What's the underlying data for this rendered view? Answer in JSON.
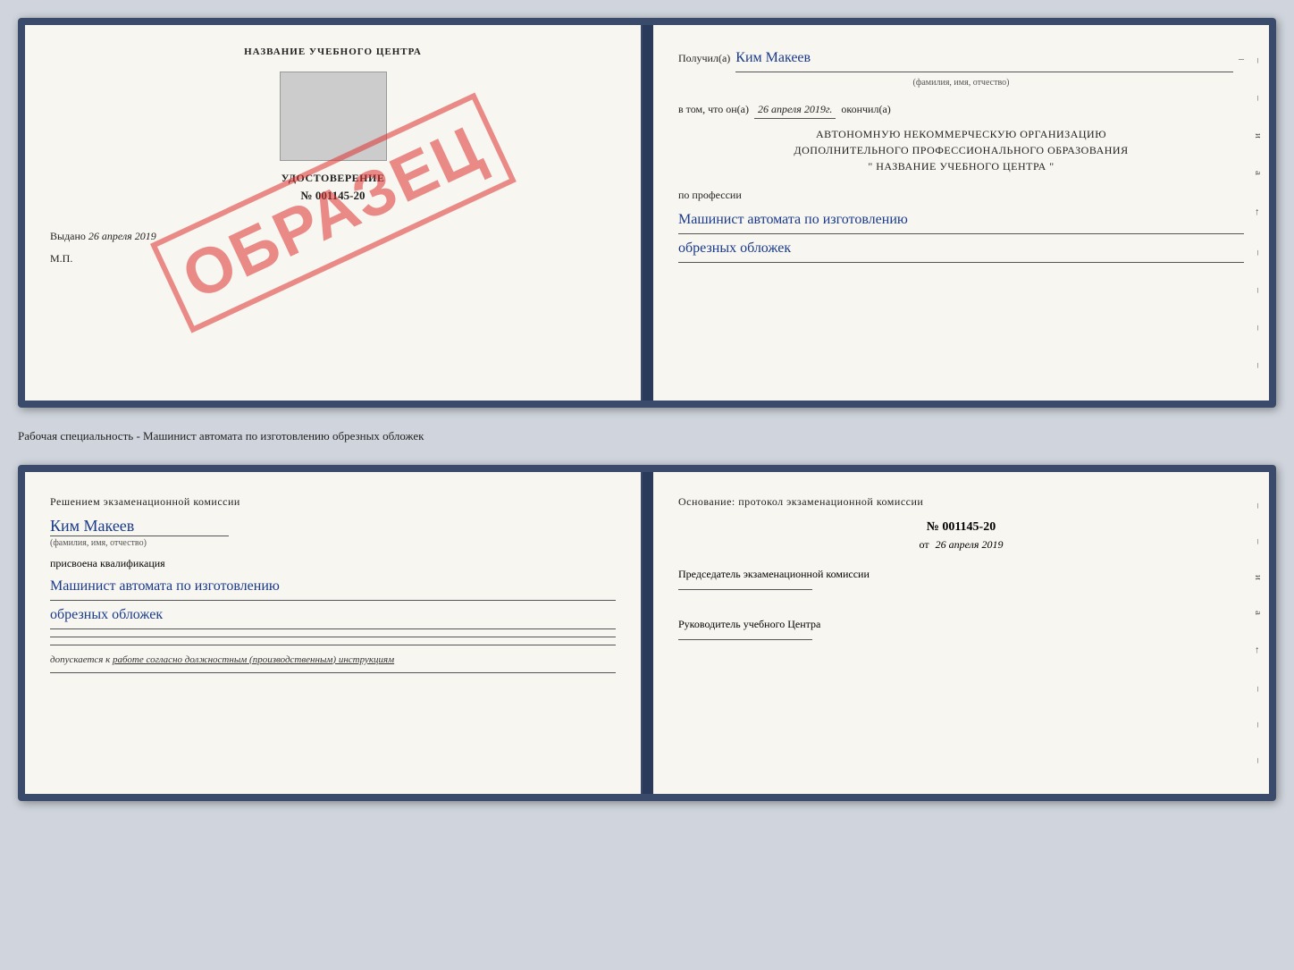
{
  "top_doc": {
    "left": {
      "header": "НАЗВАНИЕ УЧЕБНОГО ЦЕНТРА",
      "cert_label": "УДОСТОВЕРЕНИЕ",
      "cert_number": "№ 001145-20",
      "vydano_label": "Выдано",
      "vydano_date": "26 апреля 2019",
      "mp_label": "М.П.",
      "obrazets": "ОБРАЗЕЦ"
    },
    "right": {
      "poluchil_label": "Получил(а)",
      "poluchil_name": "Ким Макеев",
      "fio_label": "(фамилия, имя, отчество)",
      "vtom_label": "в том, что он(а)",
      "vtom_date": "26 апреля 2019г.",
      "okoncil_label": "окончил(а)",
      "org_line1": "АВТОНОМНУЮ НЕКОММЕРЧЕСКУЮ ОРГАНИЗАЦИЮ",
      "org_line2": "ДОПОЛНИТЕЛЬНОГО ПРОФЕССИОНАЛЬНОГО ОБРАЗОВАНИЯ",
      "org_line3": "\"  НАЗВАНИЕ УЧЕБНОГО ЦЕНТРА  \"",
      "po_professii": "по профессии",
      "profession1": "Машинист автомата по изготовлению",
      "profession2": "обрезных обложек"
    }
  },
  "specialty_label": "Рабочая специальность - Машинист автомата по изготовлению обрезных обложек",
  "bottom_doc": {
    "left": {
      "reshen_label": "Решением экзаменационной комиссии",
      "name": "Ким Макеев",
      "fio_label": "(фамилия, имя, отчество)",
      "prisvoena": "присвоена квалификация",
      "kvalif1": "Машинист автомата по изготовлению",
      "kvalif2": "обрезных обложек",
      "dopusk_prefix": "допускается к",
      "dopusk_text": "работе согласно должностным (производственным) инструкциям"
    },
    "right": {
      "osnovanie_label": "Основание: протокол экзаменационной комиссии",
      "protocol_number": "№  001145-20",
      "ot_label": "от",
      "protocol_date": "26 апреля 2019",
      "predsedatel_label": "Председатель экзаменационной комиссии",
      "rukovoditel_label": "Руководитель учебного Центра"
    }
  }
}
